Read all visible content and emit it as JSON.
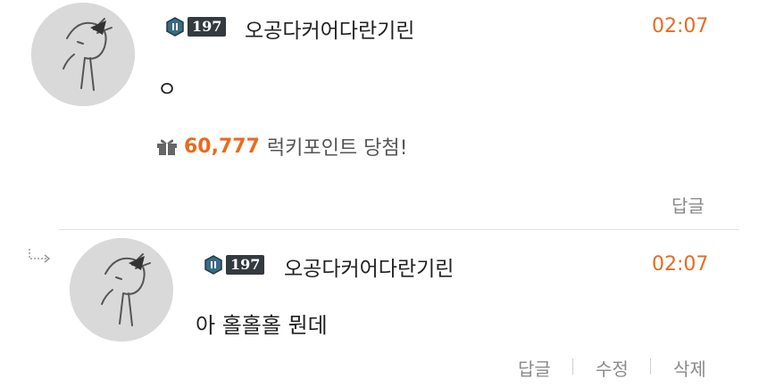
{
  "comments": [
    {
      "level": "197",
      "nickname": "오공다커어다란기린",
      "time": "02:07",
      "message": "ㅇ",
      "lucky": {
        "amount": "60,777",
        "text": "럭키포인트 당첨!"
      },
      "actions": {
        "reply": "답글"
      }
    },
    {
      "level": "197",
      "nickname": "오공다커어다란기린",
      "time": "02:07",
      "message": "아 홀홀홀 뭔데",
      "actions": {
        "reply": "답글",
        "edit": "수정",
        "delete": "삭제"
      }
    }
  ],
  "colors": {
    "accent": "#e86b1f",
    "muted": "#8a8a8a",
    "divider": "#e3e3e3"
  },
  "icons": [
    "gift-icon",
    "reply-arrow-icon",
    "level-emblem-icon"
  ]
}
